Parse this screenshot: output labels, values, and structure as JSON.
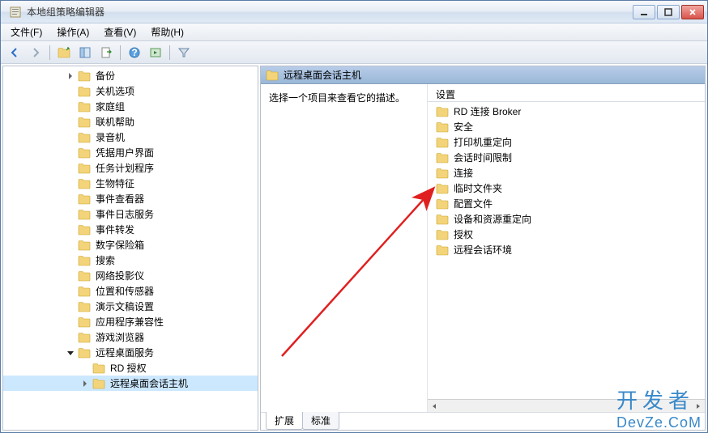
{
  "window": {
    "title": "本地组策略编辑器"
  },
  "menubar": [
    {
      "label": "文件(F)"
    },
    {
      "label": "操作(A)"
    },
    {
      "label": "查看(V)"
    },
    {
      "label": "帮助(H)"
    }
  ],
  "tree": {
    "items": [
      {
        "label": "备份",
        "expandable": true
      },
      {
        "label": "关机选项"
      },
      {
        "label": "家庭组"
      },
      {
        "label": "联机帮助"
      },
      {
        "label": "录音机"
      },
      {
        "label": "凭据用户界面"
      },
      {
        "label": "任务计划程序"
      },
      {
        "label": "生物特征"
      },
      {
        "label": "事件查看器"
      },
      {
        "label": "事件日志服务"
      },
      {
        "label": "事件转发"
      },
      {
        "label": "数字保险箱"
      },
      {
        "label": "搜索"
      },
      {
        "label": "网络投影仪"
      },
      {
        "label": "位置和传感器"
      },
      {
        "label": "演示文稿设置"
      },
      {
        "label": "应用程序兼容性"
      },
      {
        "label": "游戏浏览器"
      },
      {
        "label": "远程桌面服务",
        "expanded": true,
        "children": [
          {
            "label": "RD 授权"
          },
          {
            "label": "远程桌面会话主机",
            "expandable": true,
            "selected": true
          }
        ]
      }
    ]
  },
  "right": {
    "header": "远程桌面会话主机",
    "description_prompt": "选择一个项目来查看它的描述。",
    "column": "设置",
    "items": [
      {
        "label": "RD 连接 Broker"
      },
      {
        "label": "安全"
      },
      {
        "label": "打印机重定向"
      },
      {
        "label": "会话时间限制"
      },
      {
        "label": "连接"
      },
      {
        "label": "临时文件夹"
      },
      {
        "label": "配置文件"
      },
      {
        "label": "设备和资源重定向"
      },
      {
        "label": "授权"
      },
      {
        "label": "远程会话环境"
      }
    ],
    "tabs": [
      {
        "label": "扩展",
        "active": true
      },
      {
        "label": "标准",
        "active": false
      }
    ]
  },
  "watermark": {
    "line1": "开发者",
    "line2": "DevZe.CoM"
  }
}
